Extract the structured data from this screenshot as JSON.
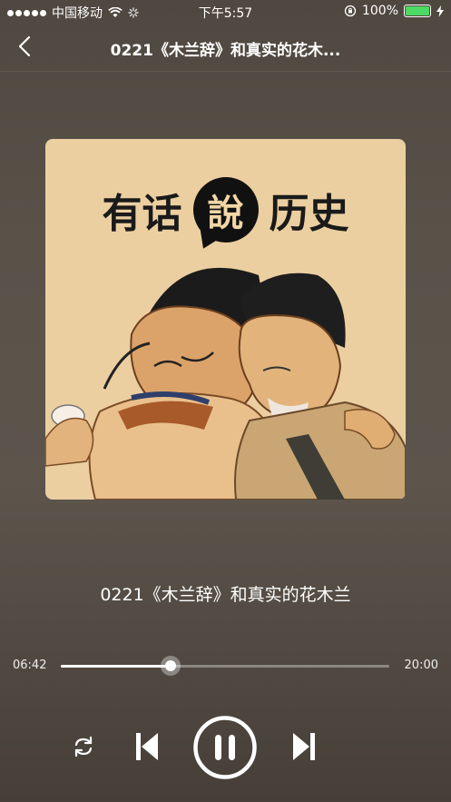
{
  "status_bar": {
    "carrier": "中国移动",
    "time": "下午5:57",
    "battery": "100%"
  },
  "nav": {
    "title": "0221《木兰辞》和真实的花木..."
  },
  "cover": {
    "title_left": "有话",
    "title_bubble": "說",
    "title_right": "历史"
  },
  "track": {
    "title": "0221《木兰辞》和真实的花木兰"
  },
  "player": {
    "current_time": "06:42",
    "total_time": "20:00",
    "progress_fraction": 0.335
  },
  "controls": {
    "repeat_icon": "repeat-icon",
    "prev_icon": "skip-previous-icon",
    "pause_icon": "pause-icon",
    "next_icon": "skip-next-icon"
  }
}
